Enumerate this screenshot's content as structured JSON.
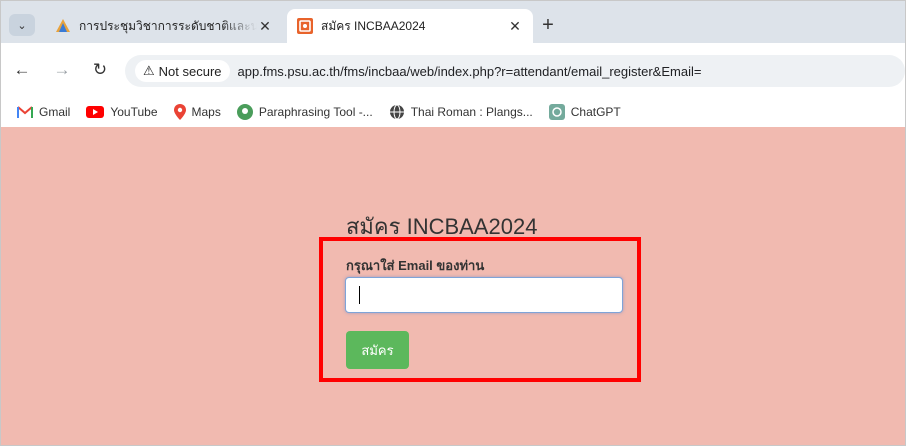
{
  "browser": {
    "tabs": [
      {
        "label": "การประชุมวิชาการระดับชาติและนานาชาติ",
        "active": false
      },
      {
        "label": "สมัคร INCBAA2024",
        "active": true
      }
    ],
    "close_glyph": "✕",
    "new_tab_glyph": "+",
    "security_label": "Not secure",
    "url": "app.fms.psu.ac.th/fms/incbaa/web/index.php?r=attendant/email_register&Email="
  },
  "bookmarks": [
    {
      "label": "Gmail",
      "icon": "gmail-icon"
    },
    {
      "label": "YouTube",
      "icon": "youtube-icon"
    },
    {
      "label": "Maps",
      "icon": "maps-icon"
    },
    {
      "label": "Paraphrasing Tool -...",
      "icon": "paraphrasing-icon"
    },
    {
      "label": "Thai Roman : Plangs...",
      "icon": "globe-icon"
    },
    {
      "label": "ChatGPT",
      "icon": "chatgpt-icon"
    }
  ],
  "page": {
    "title": "สมัคร INCBAA2024",
    "email_label": "กรุณาใส่ Email ของท่าน",
    "email_value": "",
    "submit_label": "สมัคร",
    "colors": {
      "background": "#f1bab0",
      "button": "#5cb85c",
      "highlight": "#ff0000"
    }
  }
}
